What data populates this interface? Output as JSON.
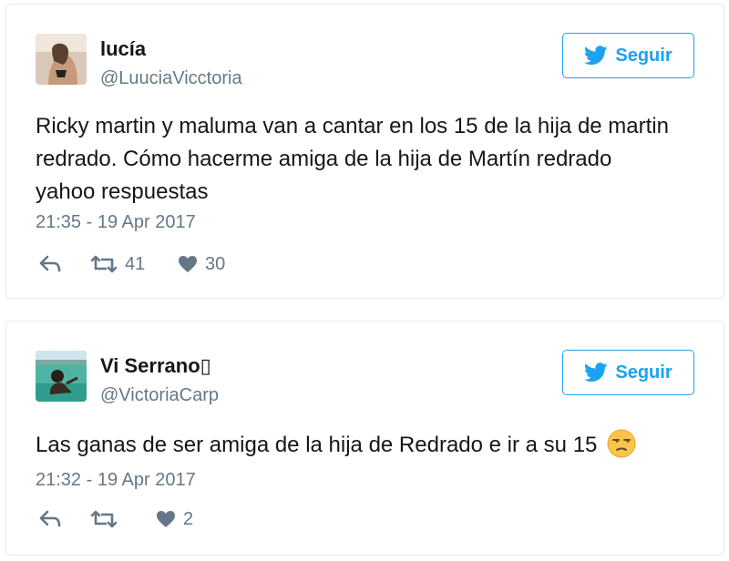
{
  "tweets": [
    {
      "display_name": "lucía",
      "handle": "@LuuciaVicctoria",
      "follow_label": "Seguir",
      "text": "Ricky martin y maluma van a cantar en los 15 de la hija de martin redrado. Cómo hacerme amiga de la hija de Martín redrado yahoo respuestas",
      "date": "21:35 - 19 Apr 2017",
      "retweets": "41",
      "likes": "30"
    },
    {
      "display_name": "Vi Serrano▯",
      "handle": "@VictoriaCarp",
      "follow_label": "Seguir",
      "text": "Las ganas de ser amiga de la hija de Redrado e ir a su 15",
      "emoji": "unamused-face",
      "date": "21:32 - 19 Apr 2017",
      "retweets": "",
      "likes": "2"
    }
  ],
  "icons": {
    "reply": "reply-icon",
    "retweet": "retweet-icon",
    "like": "heart-icon",
    "follow": "twitter-bird-icon"
  },
  "colors": {
    "accent": "#1da1f2",
    "secondary_text": "#657786",
    "action_icon": "#657786",
    "border": "#e1e8ed"
  }
}
